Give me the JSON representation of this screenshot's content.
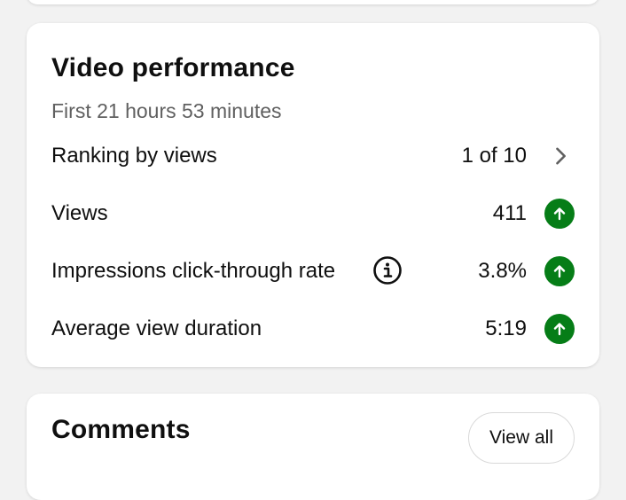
{
  "video_performance": {
    "title": "Video performance",
    "subtitle": "First 21 hours 53 minutes",
    "rows": [
      {
        "label": "Ranking by views",
        "value": "1 of 10",
        "trailing_icon": "chevron-right-icon"
      },
      {
        "label": "Views",
        "value": "411",
        "trailing_icon": "arrow-up-circle-icon"
      },
      {
        "label": "Impressions click-through rate",
        "value": "3.8%",
        "trailing_icon": "arrow-up-circle-icon",
        "has_info_icon": true
      },
      {
        "label": "Average view duration",
        "value": "5:19",
        "trailing_icon": "arrow-up-circle-icon"
      }
    ]
  },
  "comments": {
    "title": "Comments",
    "view_all_label": "View all"
  },
  "colors": {
    "trend_up": "#067d17",
    "card_background": "#ffffff",
    "page_background": "#f2f2f2",
    "secondary_text": "#606060"
  }
}
